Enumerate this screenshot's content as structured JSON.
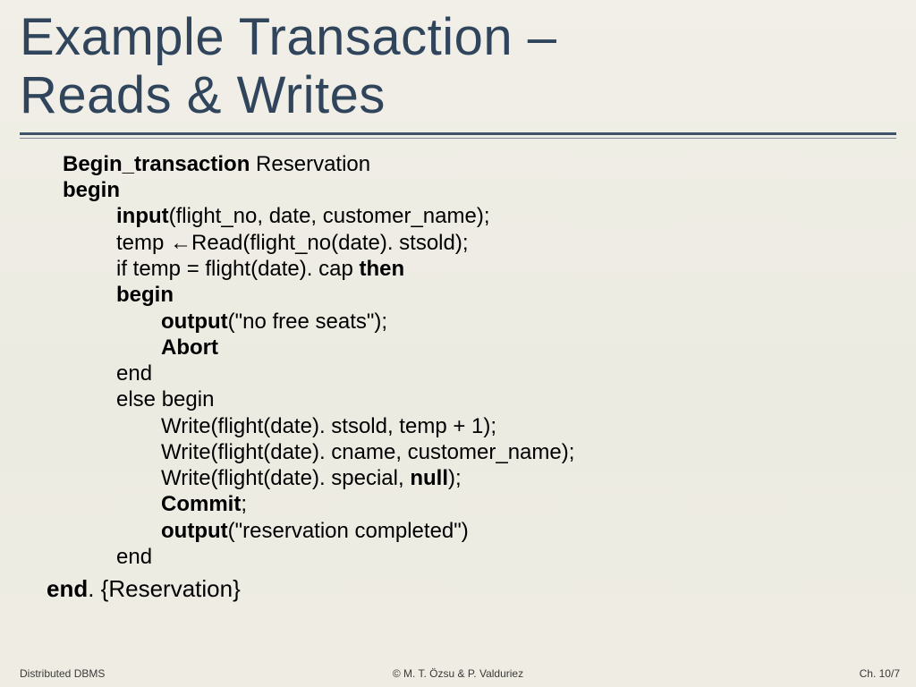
{
  "title_line1": "Example Transaction –",
  "title_line2": "Reads & Writes",
  "code": {
    "l1_a": "Begin_transaction",
    "l1_b": " Reservation",
    "l2": "begin",
    "l3_a": "input",
    "l3_b": "(flight_no, date, customer_name);",
    "l4": "temp ←Read(flight_no(date). stsold);",
    "l5_a": "if temp = flight(date). cap ",
    "l5_b": "then",
    "l6": "begin",
    "l7_a": "output",
    "l7_b": "(\"no free seats\");",
    "l8": "Abort",
    "l9": "end",
    "l10": "else begin",
    "l11": "Write(flight(date). stsold, temp + 1);",
    "l12": "Write(flight(date). cname, customer_name);",
    "l13_a": "Write(flight(date). special, ",
    "l13_b": "null",
    "l13_c": ");",
    "l14_a": "Commit",
    "l14_b": ";",
    "l15_a": "output",
    "l15_b": "(\"reservation completed\")",
    "l16": "end",
    "l17_a": "end",
    "l17_b": ". {Reservation}"
  },
  "footer": {
    "left": "Distributed DBMS",
    "center": "© M. T. Özsu & P. Valduriez",
    "right": "Ch. 10/7"
  }
}
